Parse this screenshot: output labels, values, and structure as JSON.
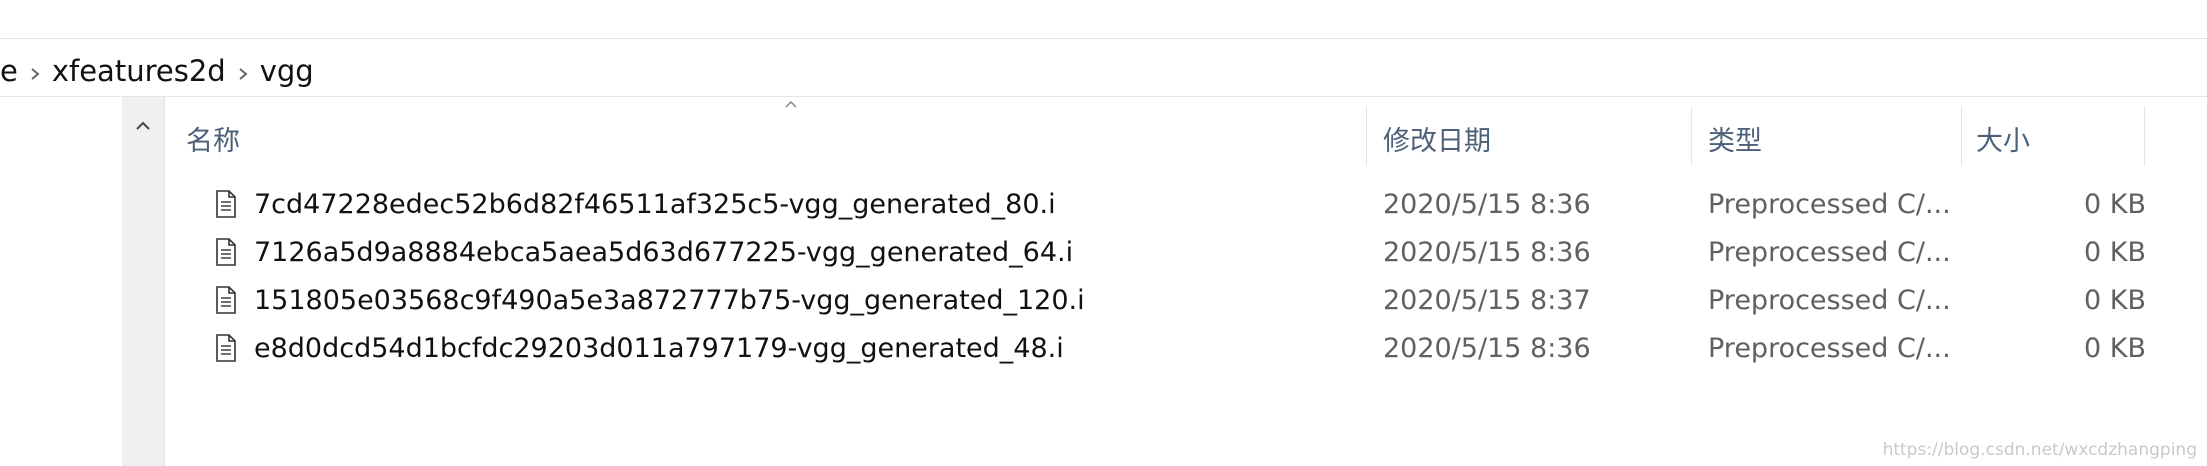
{
  "breadcrumb": {
    "items": [
      "e",
      "xfeatures2d",
      "vgg"
    ]
  },
  "columns": {
    "name": "名称",
    "date": "修改日期",
    "type": "类型",
    "size": "大小"
  },
  "sort": {
    "column": "name",
    "direction": "ascending"
  },
  "files": [
    {
      "name": "7cd47228edec52b6d82f46511af325c5-vgg_generated_80.i",
      "date": "2020/5/15 8:36",
      "type": "Preprocessed C/...",
      "size": "0 KB"
    },
    {
      "name": "7126a5d9a8884ebca5aea5d63d677225-vgg_generated_64.i",
      "date": "2020/5/15 8:36",
      "type": "Preprocessed C/...",
      "size": "0 KB"
    },
    {
      "name": "151805e03568c9f490a5e3a872777b75-vgg_generated_120.i",
      "date": "2020/5/15 8:37",
      "type": "Preprocessed C/...",
      "size": "0 KB"
    },
    {
      "name": "e8d0dcd54d1bcfdc29203d011a797179-vgg_generated_48.i",
      "date": "2020/5/15 8:36",
      "type": "Preprocessed C/...",
      "size": "0 KB"
    }
  ],
  "watermark": "https://blog.csdn.net/wxcdzhangping",
  "icons": {
    "breadcrumb_separator": "chevron-right-icon",
    "sort_indicator": "chevron-up-icon",
    "scroll_up": "chevron-up-icon",
    "file": "text-file-icon"
  }
}
